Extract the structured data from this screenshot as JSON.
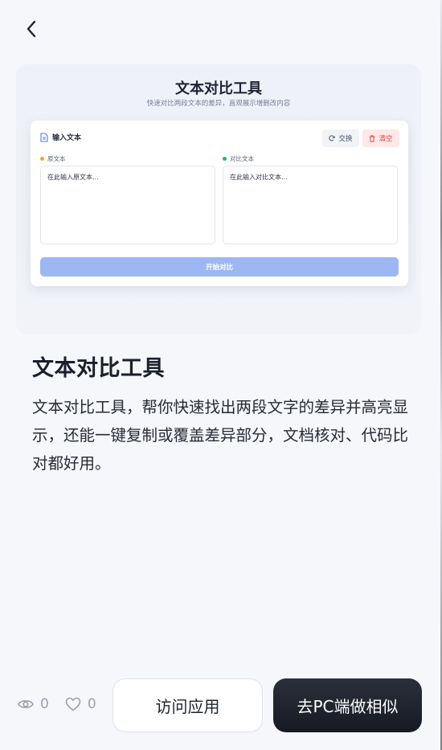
{
  "nav": {
    "back_icon": "chevron-left-icon"
  },
  "preview": {
    "title": "文本对比工具",
    "subtitle": "快速对比两段文本的差异，直观展示增删改内容",
    "panel_title": "输入文本",
    "swap_label": "交换",
    "clear_label": "清空",
    "original_label": "原文本",
    "original_placeholder": "在此输入原文本...",
    "compare_label": "对比文本",
    "compare_placeholder": "在此输入对比文本...",
    "start_button": "开始对比",
    "colors": {
      "accent": "#9db7f3",
      "original_dot": "#f5a623",
      "compare_dot": "#22b573",
      "danger": "#e04848"
    }
  },
  "app": {
    "title": "文本对比工具",
    "description": "文本对比工具，帮你快速找出两段文字的差异并高亮显示，还能一键复制或覆盖差异部分，文档核对、代码比对都好用。"
  },
  "stats": {
    "views": "0",
    "likes": "0"
  },
  "actions": {
    "visit_label": "访问应用",
    "pc_label": "去PC端做相似"
  }
}
